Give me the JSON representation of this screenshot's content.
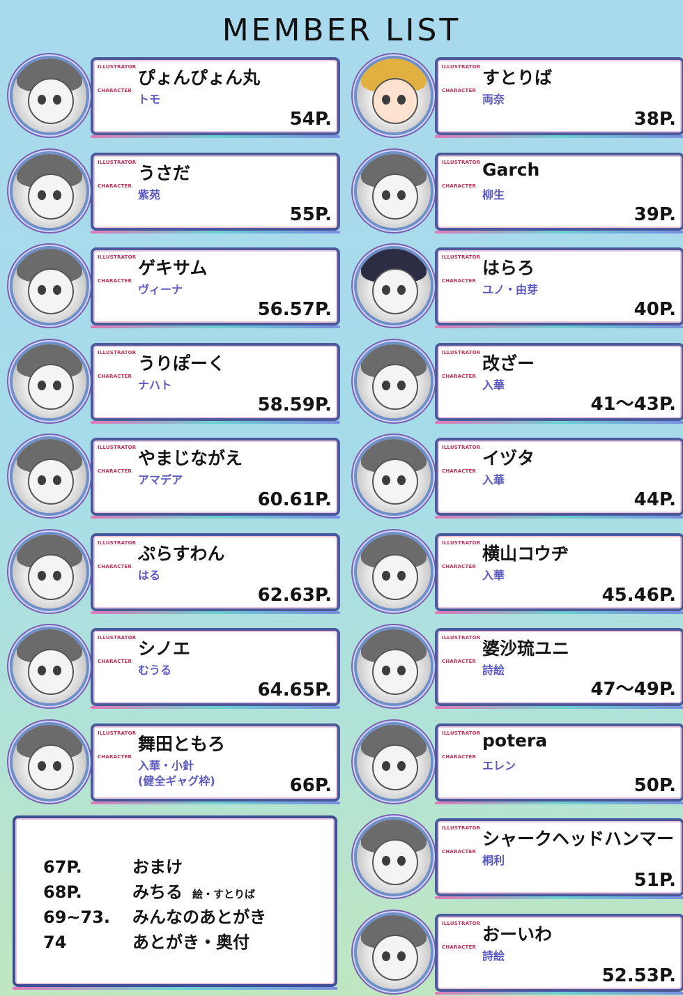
{
  "title": "MEMBER LIST",
  "labels": {
    "illustrator": "ILLUSTRATOR",
    "character": "CHARACTER"
  },
  "left_column": [
    {
      "illustrator": "ぴょんぴょん丸",
      "character": "トモ",
      "pages": "54P."
    },
    {
      "illustrator": "うさだ",
      "character": "紫苑",
      "pages": "55P."
    },
    {
      "illustrator": "ゲキサム",
      "character": "ヴィーナ",
      "pages": "56.57P."
    },
    {
      "illustrator": "うりぽーく",
      "character": "ナハト",
      "pages": "58.59P."
    },
    {
      "illustrator": "やまじながえ",
      "character": "アマデア",
      "pages": "60.61P."
    },
    {
      "illustrator": "ぷらすわん",
      "character": "はる",
      "pages": "62.63P."
    },
    {
      "illustrator": "シノエ",
      "character": "むうる",
      "pages": "64.65P."
    },
    {
      "illustrator": "舞田ともろ",
      "character": "入華・小針",
      "character_note": "(健全ギャグ枠)",
      "pages": "66P."
    }
  ],
  "right_column": [
    {
      "illustrator": "すとりば",
      "character": "両奈",
      "pages": "38P."
    },
    {
      "illustrator": "Garch",
      "character": "柳生",
      "pages": "39P."
    },
    {
      "illustrator": "はらろ",
      "character": "ユノ・由芽",
      "pages": "40P."
    },
    {
      "illustrator": "改ざー",
      "character": "入華",
      "pages": "41～43P."
    },
    {
      "illustrator": "イヅタ",
      "character": "入華",
      "pages": "44P."
    },
    {
      "illustrator": "横山コウヂ",
      "character": "入華",
      "pages": "45.46P."
    },
    {
      "illustrator": "婆沙琉ユニ",
      "character": "詩絵",
      "pages": "47～49P."
    },
    {
      "illustrator": "potera",
      "character": "エレン",
      "pages": "50P."
    },
    {
      "illustrator": "シャークヘッドハンマー",
      "character": "桐利",
      "pages": "51P."
    },
    {
      "illustrator": "おーいわ",
      "character": "詩絵",
      "pages": "52.53P."
    }
  ],
  "contents": [
    {
      "pages": "67P.",
      "title": "おまけ",
      "note": ""
    },
    {
      "pages": "68P.",
      "title": "みちる",
      "note": "絵・すとりば"
    },
    {
      "pages": "69~73.",
      "title": "みんなのあとがき",
      "note": ""
    },
    {
      "pages": "74",
      "title": "あとがき・奥付",
      "note": ""
    }
  ]
}
